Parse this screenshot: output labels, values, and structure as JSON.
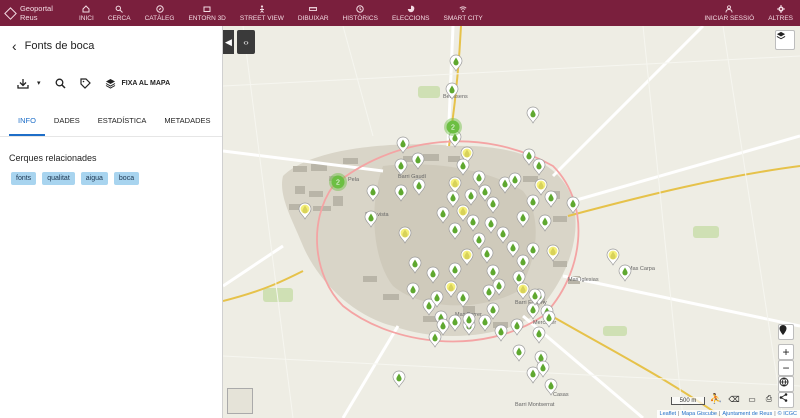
{
  "app": {
    "title": "Geoportal Reus"
  },
  "nav": [
    {
      "label": "INICI",
      "icon": "home-icon"
    },
    {
      "label": "CERCA",
      "icon": "search-icon"
    },
    {
      "label": "CATÀLEG",
      "icon": "compass-icon"
    },
    {
      "label": "ENTORN 3D",
      "icon": "box-icon"
    },
    {
      "label": "STREET VIEW",
      "icon": "pegman-icon"
    },
    {
      "label": "DIBUIXAR",
      "icon": "ruler-icon"
    },
    {
      "label": "HISTÒRICS",
      "icon": "clock-icon"
    },
    {
      "label": "ELECCIONS",
      "icon": "pie-icon"
    },
    {
      "label": "SMART CITY",
      "icon": "wifi-icon"
    }
  ],
  "nav_right": [
    {
      "label": "INICIAR SESSIÓ",
      "icon": "user-icon"
    },
    {
      "label": "ALTRES",
      "icon": "gear-icon"
    }
  ],
  "panel": {
    "back_icon": "chevron-left-icon",
    "title": "Fonts de boca",
    "fixa_label": "FIXA AL MAPA",
    "tabs": [
      "INFO",
      "DADES",
      "ESTADÍSTICA",
      "METADADES"
    ],
    "active_tab": "INFO",
    "related_title": "Cerques relacionades",
    "tags": [
      "fonts",
      "qualitat",
      "aigua",
      "boca"
    ]
  },
  "map": {
    "clusters": [
      "2",
      "2"
    ],
    "scale_label": "500 m",
    "attribution": [
      "Leaflet",
      "Mapa Giscube",
      "Ajuntament de Reus",
      "© ICGC"
    ],
    "place_labels": [
      "Bellissens",
      "Barri Gaudí",
      "Sol i vista",
      "Barri Fortuny",
      "Mercader",
      "Mas Ferrer",
      "Mas Iglesias",
      "Mas Carpa",
      "Barri Montserrat",
      "Casas",
      "Pela"
    ],
    "colors": {
      "marker": "#5fa830",
      "highlight": "#f4ef7a",
      "cluster": "#6cbf42",
      "accent": "#7a1f3d"
    }
  }
}
